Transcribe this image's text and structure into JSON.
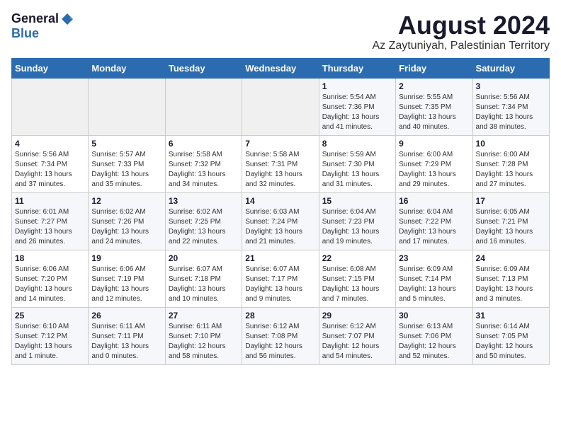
{
  "logo": {
    "general": "General",
    "blue": "Blue"
  },
  "title": "August 2024",
  "subtitle": "Az Zaytuniyah, Palestinian Territory",
  "days_of_week": [
    "Sunday",
    "Monday",
    "Tuesday",
    "Wednesday",
    "Thursday",
    "Friday",
    "Saturday"
  ],
  "weeks": [
    [
      {
        "day": "",
        "sunrise": "",
        "sunset": "",
        "daylight": "",
        "empty": true
      },
      {
        "day": "",
        "sunrise": "",
        "sunset": "",
        "daylight": "",
        "empty": true
      },
      {
        "day": "",
        "sunrise": "",
        "sunset": "",
        "daylight": "",
        "empty": true
      },
      {
        "day": "",
        "sunrise": "",
        "sunset": "",
        "daylight": "",
        "empty": true
      },
      {
        "day": "1",
        "sunrise": "Sunrise: 5:54 AM",
        "sunset": "Sunset: 7:36 PM",
        "daylight": "Daylight: 13 hours and 41 minutes."
      },
      {
        "day": "2",
        "sunrise": "Sunrise: 5:55 AM",
        "sunset": "Sunset: 7:35 PM",
        "daylight": "Daylight: 13 hours and 40 minutes."
      },
      {
        "day": "3",
        "sunrise": "Sunrise: 5:56 AM",
        "sunset": "Sunset: 7:34 PM",
        "daylight": "Daylight: 13 hours and 38 minutes."
      }
    ],
    [
      {
        "day": "4",
        "sunrise": "Sunrise: 5:56 AM",
        "sunset": "Sunset: 7:34 PM",
        "daylight": "Daylight: 13 hours and 37 minutes."
      },
      {
        "day": "5",
        "sunrise": "Sunrise: 5:57 AM",
        "sunset": "Sunset: 7:33 PM",
        "daylight": "Daylight: 13 hours and 35 minutes."
      },
      {
        "day": "6",
        "sunrise": "Sunrise: 5:58 AM",
        "sunset": "Sunset: 7:32 PM",
        "daylight": "Daylight: 13 hours and 34 minutes."
      },
      {
        "day": "7",
        "sunrise": "Sunrise: 5:58 AM",
        "sunset": "Sunset: 7:31 PM",
        "daylight": "Daylight: 13 hours and 32 minutes."
      },
      {
        "day": "8",
        "sunrise": "Sunrise: 5:59 AM",
        "sunset": "Sunset: 7:30 PM",
        "daylight": "Daylight: 13 hours and 31 minutes."
      },
      {
        "day": "9",
        "sunrise": "Sunrise: 6:00 AM",
        "sunset": "Sunset: 7:29 PM",
        "daylight": "Daylight: 13 hours and 29 minutes."
      },
      {
        "day": "10",
        "sunrise": "Sunrise: 6:00 AM",
        "sunset": "Sunset: 7:28 PM",
        "daylight": "Daylight: 13 hours and 27 minutes."
      }
    ],
    [
      {
        "day": "11",
        "sunrise": "Sunrise: 6:01 AM",
        "sunset": "Sunset: 7:27 PM",
        "daylight": "Daylight: 13 hours and 26 minutes."
      },
      {
        "day": "12",
        "sunrise": "Sunrise: 6:02 AM",
        "sunset": "Sunset: 7:26 PM",
        "daylight": "Daylight: 13 hours and 24 minutes."
      },
      {
        "day": "13",
        "sunrise": "Sunrise: 6:02 AM",
        "sunset": "Sunset: 7:25 PM",
        "daylight": "Daylight: 13 hours and 22 minutes."
      },
      {
        "day": "14",
        "sunrise": "Sunrise: 6:03 AM",
        "sunset": "Sunset: 7:24 PM",
        "daylight": "Daylight: 13 hours and 21 minutes."
      },
      {
        "day": "15",
        "sunrise": "Sunrise: 6:04 AM",
        "sunset": "Sunset: 7:23 PM",
        "daylight": "Daylight: 13 hours and 19 minutes."
      },
      {
        "day": "16",
        "sunrise": "Sunrise: 6:04 AM",
        "sunset": "Sunset: 7:22 PM",
        "daylight": "Daylight: 13 hours and 17 minutes."
      },
      {
        "day": "17",
        "sunrise": "Sunrise: 6:05 AM",
        "sunset": "Sunset: 7:21 PM",
        "daylight": "Daylight: 13 hours and 16 minutes."
      }
    ],
    [
      {
        "day": "18",
        "sunrise": "Sunrise: 6:06 AM",
        "sunset": "Sunset: 7:20 PM",
        "daylight": "Daylight: 13 hours and 14 minutes."
      },
      {
        "day": "19",
        "sunrise": "Sunrise: 6:06 AM",
        "sunset": "Sunset: 7:19 PM",
        "daylight": "Daylight: 13 hours and 12 minutes."
      },
      {
        "day": "20",
        "sunrise": "Sunrise: 6:07 AM",
        "sunset": "Sunset: 7:18 PM",
        "daylight": "Daylight: 13 hours and 10 minutes."
      },
      {
        "day": "21",
        "sunrise": "Sunrise: 6:07 AM",
        "sunset": "Sunset: 7:17 PM",
        "daylight": "Daylight: 13 hours and 9 minutes."
      },
      {
        "day": "22",
        "sunrise": "Sunrise: 6:08 AM",
        "sunset": "Sunset: 7:15 PM",
        "daylight": "Daylight: 13 hours and 7 minutes."
      },
      {
        "day": "23",
        "sunrise": "Sunrise: 6:09 AM",
        "sunset": "Sunset: 7:14 PM",
        "daylight": "Daylight: 13 hours and 5 minutes."
      },
      {
        "day": "24",
        "sunrise": "Sunrise: 6:09 AM",
        "sunset": "Sunset: 7:13 PM",
        "daylight": "Daylight: 13 hours and 3 minutes."
      }
    ],
    [
      {
        "day": "25",
        "sunrise": "Sunrise: 6:10 AM",
        "sunset": "Sunset: 7:12 PM",
        "daylight": "Daylight: 13 hours and 1 minute."
      },
      {
        "day": "26",
        "sunrise": "Sunrise: 6:11 AM",
        "sunset": "Sunset: 7:11 PM",
        "daylight": "Daylight: 13 hours and 0 minutes."
      },
      {
        "day": "27",
        "sunrise": "Sunrise: 6:11 AM",
        "sunset": "Sunset: 7:10 PM",
        "daylight": "Daylight: 12 hours and 58 minutes."
      },
      {
        "day": "28",
        "sunrise": "Sunrise: 6:12 AM",
        "sunset": "Sunset: 7:08 PM",
        "daylight": "Daylight: 12 hours and 56 minutes."
      },
      {
        "day": "29",
        "sunrise": "Sunrise: 6:12 AM",
        "sunset": "Sunset: 7:07 PM",
        "daylight": "Daylight: 12 hours and 54 minutes."
      },
      {
        "day": "30",
        "sunrise": "Sunrise: 6:13 AM",
        "sunset": "Sunset: 7:06 PM",
        "daylight": "Daylight: 12 hours and 52 minutes."
      },
      {
        "day": "31",
        "sunrise": "Sunrise: 6:14 AM",
        "sunset": "Sunset: 7:05 PM",
        "daylight": "Daylight: 12 hours and 50 minutes."
      }
    ]
  ]
}
